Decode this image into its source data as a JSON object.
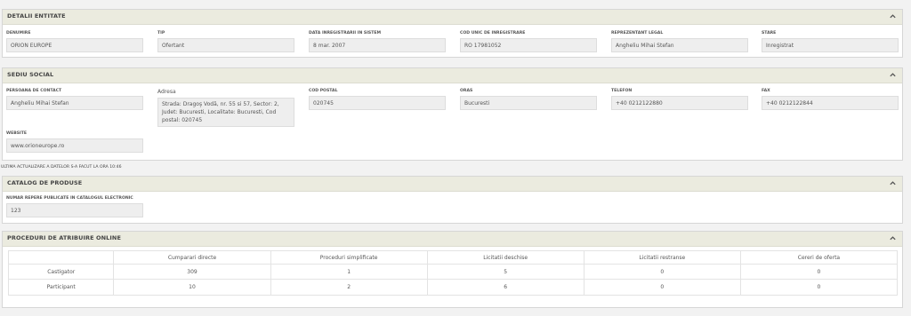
{
  "detalii": {
    "title": "DETALII ENTITATE",
    "fields": [
      {
        "label": "DENUMIRE",
        "value": "ORION EUROPE"
      },
      {
        "label": "TIP",
        "value": "Ofertant"
      },
      {
        "label": "DATA INREGISTRARII IN SISTEM",
        "value": "8 mar. 2007"
      },
      {
        "label": "COD UNIC DE INREGISTRARE",
        "value": "RO 17981052"
      },
      {
        "label": "REPREZENTANT LEGAL",
        "value": "Angheliu Mihai Stefan"
      },
      {
        "label": "STARE",
        "value": "Inregistrat"
      }
    ]
  },
  "sediu": {
    "title": "SEDIU SOCIAL",
    "fields": [
      {
        "label": "PERSOANA DE CONTACT",
        "value": "Angheliu Mihai Stefan"
      },
      {
        "label": "Adresa",
        "value": "Strada: Dragoş Vodă, nr. 55 si 57, Sector: 2, Judet: Bucuresti, Localitate: Bucuresti, Cod postal: 020745"
      },
      {
        "label": "COD POSTAL",
        "value": "020745"
      },
      {
        "label": "ORAS",
        "value": "Bucuresti"
      },
      {
        "label": "TELEFON",
        "value": "+40 0212122880"
      },
      {
        "label": "FAX",
        "value": "+40 0212122844"
      },
      {
        "label": "WEBSITE",
        "value": "www.orioneurope.ro"
      }
    ]
  },
  "last_update_note": "ULTIMA ACTUALIZARE A DATELOR S-A FACUT LA ORA 10:46",
  "catalog": {
    "title": "CATALOG DE PRODUSE",
    "field": {
      "label": "NUMAR REPERE PUBLICATE IN CATALOGUL ELECTRONIC",
      "value": "123"
    }
  },
  "proceduri": {
    "title": "PROCEDURI DE ATRIBUIRE ONLINE",
    "columns": [
      "",
      "Cumparari directe",
      "Proceduri simplificate",
      "Licitatii deschise",
      "Licitatii restranse",
      "Cereri de oferta"
    ],
    "rows": [
      [
        "Castigator",
        "309",
        "1",
        "5",
        "0",
        "0"
      ],
      [
        "Participant",
        "10",
        "2",
        "6",
        "0",
        "0"
      ]
    ]
  }
}
